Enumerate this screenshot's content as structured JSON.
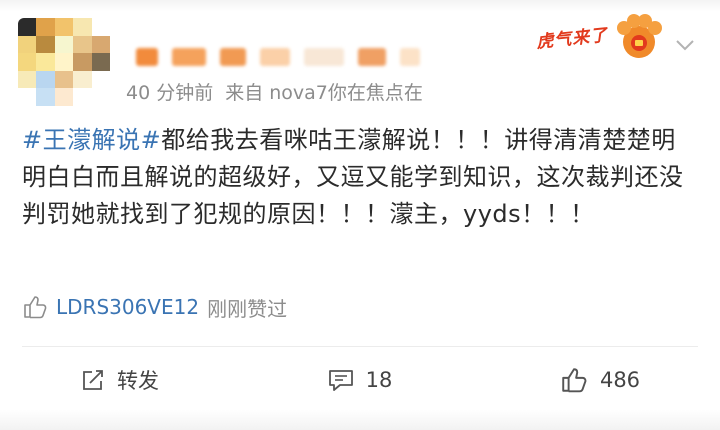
{
  "user": {
    "meta_time": "40 分钟前",
    "meta_source": "来自 nova7你在焦点在"
  },
  "badge": {
    "text": "虎气来了",
    "icon": "paw-badge-icon"
  },
  "post": {
    "hashtag": "#王濛解说#",
    "body": "都给我去看咪咕王濛解说！！！讲得清清楚楚明明白白而且解说的超级好，又逗又能学到知识，这次裁判还没判罚她就找到了犯规的原因！！！濛主，yyds！！！"
  },
  "likes": {
    "user": "LDRS306VE12",
    "text": "刚刚赞过"
  },
  "actions": {
    "repost_label": "转发",
    "comment_count": "18",
    "like_count": "486"
  },
  "colors": {
    "link": "#3a74b3",
    "meta": "#8c8c8c",
    "badge_red": "#e23a1d"
  }
}
